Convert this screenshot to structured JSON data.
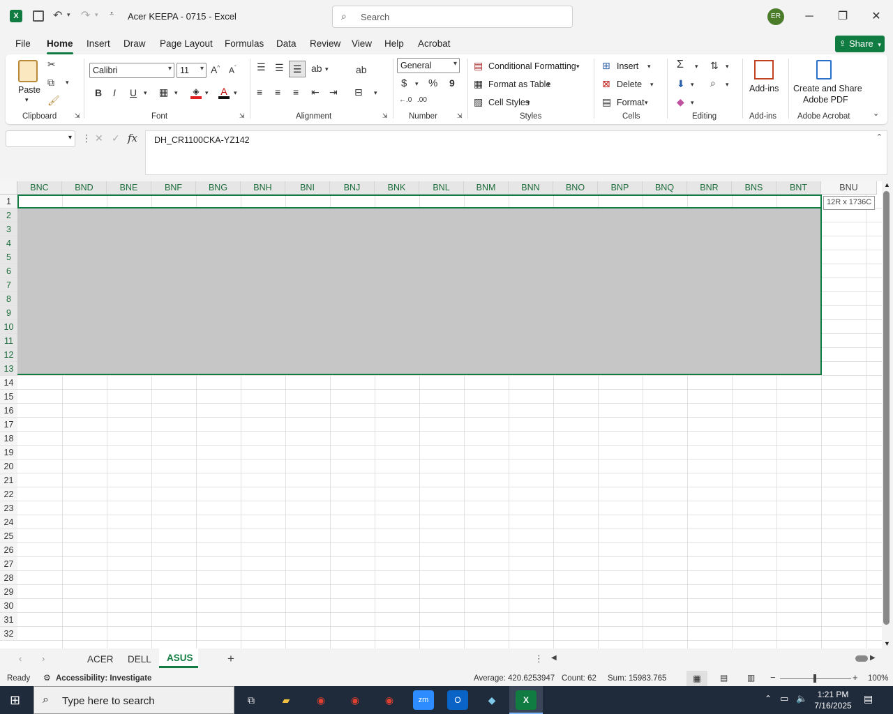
{
  "window": {
    "title": "Acer KEEPA - 0715  -  Excel",
    "search_placeholder": "Search",
    "user_initials": "ER"
  },
  "menu_tabs": [
    "File",
    "Home",
    "Insert",
    "Draw",
    "Page Layout",
    "Formulas",
    "Data",
    "Review",
    "View",
    "Help",
    "Acrobat"
  ],
  "active_tab": "Home",
  "share_label": "Share",
  "ribbon": {
    "clipboard": {
      "paste": "Paste",
      "label": "Clipboard"
    },
    "font": {
      "name": "Calibri",
      "size": "11",
      "bold": "B",
      "italic": "I",
      "underline": "U",
      "label": "Font"
    },
    "alignment": {
      "label": "Alignment"
    },
    "number": {
      "format": "General",
      "currency": "$",
      "percent": "%",
      "comma": "9",
      "label": "Number"
    },
    "styles": {
      "conditional": "Conditional Formatting",
      "format_table": "Format as Table",
      "cell_styles": "Cell Styles",
      "label": "Styles"
    },
    "cells": {
      "insert": "Insert",
      "delete": "Delete",
      "format": "Format",
      "label": "Cells"
    },
    "editing": {
      "label": "Editing"
    },
    "addins": {
      "addins": "Add-ins",
      "label": "Add-ins"
    },
    "acrobat": {
      "create_line1": "Create and Share",
      "create_line2": "Adobe PDF",
      "label": "Adobe Acrobat"
    }
  },
  "formula_bar": {
    "name_box": "",
    "fx": "fx",
    "value": "DH_CR1100CKA-YZ142"
  },
  "columns": [
    "BNC",
    "BND",
    "BNE",
    "BNF",
    "BNG",
    "BNH",
    "BNI",
    "BNJ",
    "BNK",
    "BNL",
    "BNM",
    "BNN",
    "BNO",
    "BNP",
    "BNQ",
    "BNR",
    "BNS",
    "BNT",
    "BNU"
  ],
  "rows": [
    "1",
    "2",
    "3",
    "4",
    "5",
    "6",
    "7",
    "8",
    "9",
    "10",
    "11",
    "12",
    "13",
    "14",
    "15",
    "16",
    "17",
    "18",
    "19",
    "20",
    "21",
    "22",
    "23",
    "24",
    "25",
    "26",
    "27",
    "28",
    "29",
    "30",
    "31",
    "32"
  ],
  "selection_tip": "12R x 1736C",
  "sheets": [
    "ACER",
    "DELL",
    "ASUS"
  ],
  "active_sheet": "ASUS",
  "status": {
    "ready": "Ready",
    "accessibility": "Accessibility: Investigate",
    "average": "Average: 420.6253947",
    "count": "Count: 62",
    "sum": "Sum: 15983.765",
    "zoom": "100%"
  },
  "taskbar": {
    "search_placeholder": "Type here to search",
    "time": "1:21 PM",
    "date": "7/16/2025"
  },
  "colors": {
    "accent": "#107c41",
    "selection": "#c6c6c6",
    "taskbar": "#1f2a3a"
  }
}
